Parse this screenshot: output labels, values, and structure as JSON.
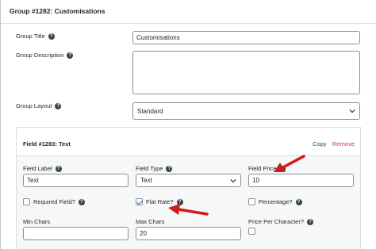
{
  "group": {
    "header_title": "Group #1282: Customisations",
    "title_label": "Group Title",
    "title_value": "Customisations",
    "description_label": "Group Description",
    "description_value": "",
    "layout_label": "Group Layout",
    "layout_value": "Standard"
  },
  "field": {
    "header_title": "Field #1283: Text",
    "copy_label": "Copy",
    "remove_label": "Remove",
    "label_label": "Field Label",
    "label_value": "Text",
    "type_label": "Field Type",
    "type_value": "Text",
    "price_label": "Field Price",
    "price_value": "10",
    "required_label": "Required Field?",
    "required_checked": false,
    "flat_rate_label": "Flat Rate?",
    "flat_rate_checked": true,
    "percentage_label": "Percentage?",
    "percentage_checked": false,
    "min_chars_label": "Min Chars",
    "min_chars_value": "",
    "max_chars_label": "Max Chars",
    "max_chars_value": "20",
    "price_per_char_label": "Price Per Character?",
    "price_per_char_checked": false
  },
  "icons": {
    "help": "question-circle-icon",
    "chevron": "chevron-down-icon",
    "annotation": "red-arrow-icon"
  },
  "colors": {
    "remove": "#d63638",
    "arrow": "#d11a1a",
    "check": "#2271b1"
  }
}
